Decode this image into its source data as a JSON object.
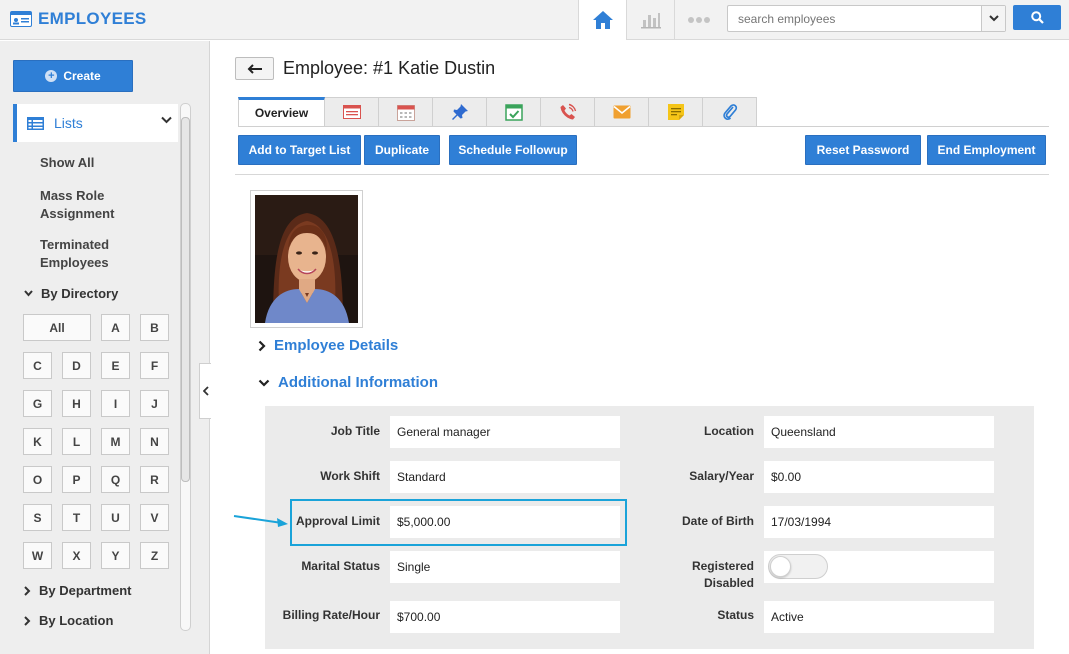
{
  "app": {
    "title": "EMPLOYEES"
  },
  "colors": {
    "accent": "#2f7fd6",
    "highlight": "#1aa3d9"
  },
  "search": {
    "placeholder": "search employees"
  },
  "sidebar": {
    "create_label": "Create",
    "lists_label": "Lists",
    "links": [
      "Show All",
      "Mass Role Assignment",
      "Terminated Employees"
    ],
    "by_directory": "By Directory",
    "letters": [
      "All",
      "A",
      "B",
      "C",
      "D",
      "E",
      "F",
      "G",
      "H",
      "I",
      "J",
      "K",
      "L",
      "M",
      "N",
      "O",
      "P",
      "Q",
      "R",
      "S",
      "T",
      "U",
      "V",
      "W",
      "X",
      "Y",
      "Z"
    ],
    "by_department": "By Department",
    "by_location": "By Location"
  },
  "page": {
    "title": "Employee: #1 Katie Dustin"
  },
  "tabs": {
    "overview": "Overview",
    "icons": [
      "ledger-icon",
      "calendar-icon",
      "pin-icon",
      "task-check-icon",
      "phone-icon",
      "mail-icon",
      "note-icon",
      "attachment-icon"
    ]
  },
  "actions": {
    "add_to_target_list": "Add to Target List",
    "duplicate": "Duplicate",
    "schedule_followup": "Schedule Followup",
    "reset_password": "Reset Password",
    "end_employment": "End Employment"
  },
  "sections": {
    "employee_details": "Employee Details",
    "additional_information": "Additional Information"
  },
  "fields": {
    "job_title": {
      "label": "Job Title",
      "value": "General manager"
    },
    "work_shift": {
      "label": "Work Shift",
      "value": "Standard"
    },
    "approval_limit": {
      "label": "Approval Limit",
      "value": "$5,000.00"
    },
    "marital_status": {
      "label": "Marital Status",
      "value": "Single"
    },
    "billing_rate": {
      "label": "Billing Rate/Hour",
      "value": "$700.00"
    },
    "location": {
      "label": "Location",
      "value": "Queensland"
    },
    "salary": {
      "label": "Salary/Year",
      "value": "$0.00"
    },
    "dob": {
      "label": "Date of Birth",
      "value": "17/03/1994"
    },
    "registered_disabled": {
      "label_line1": "Registered",
      "label_line2": "Disabled",
      "value": "off"
    },
    "status": {
      "label": "Status",
      "value": "Active"
    }
  }
}
